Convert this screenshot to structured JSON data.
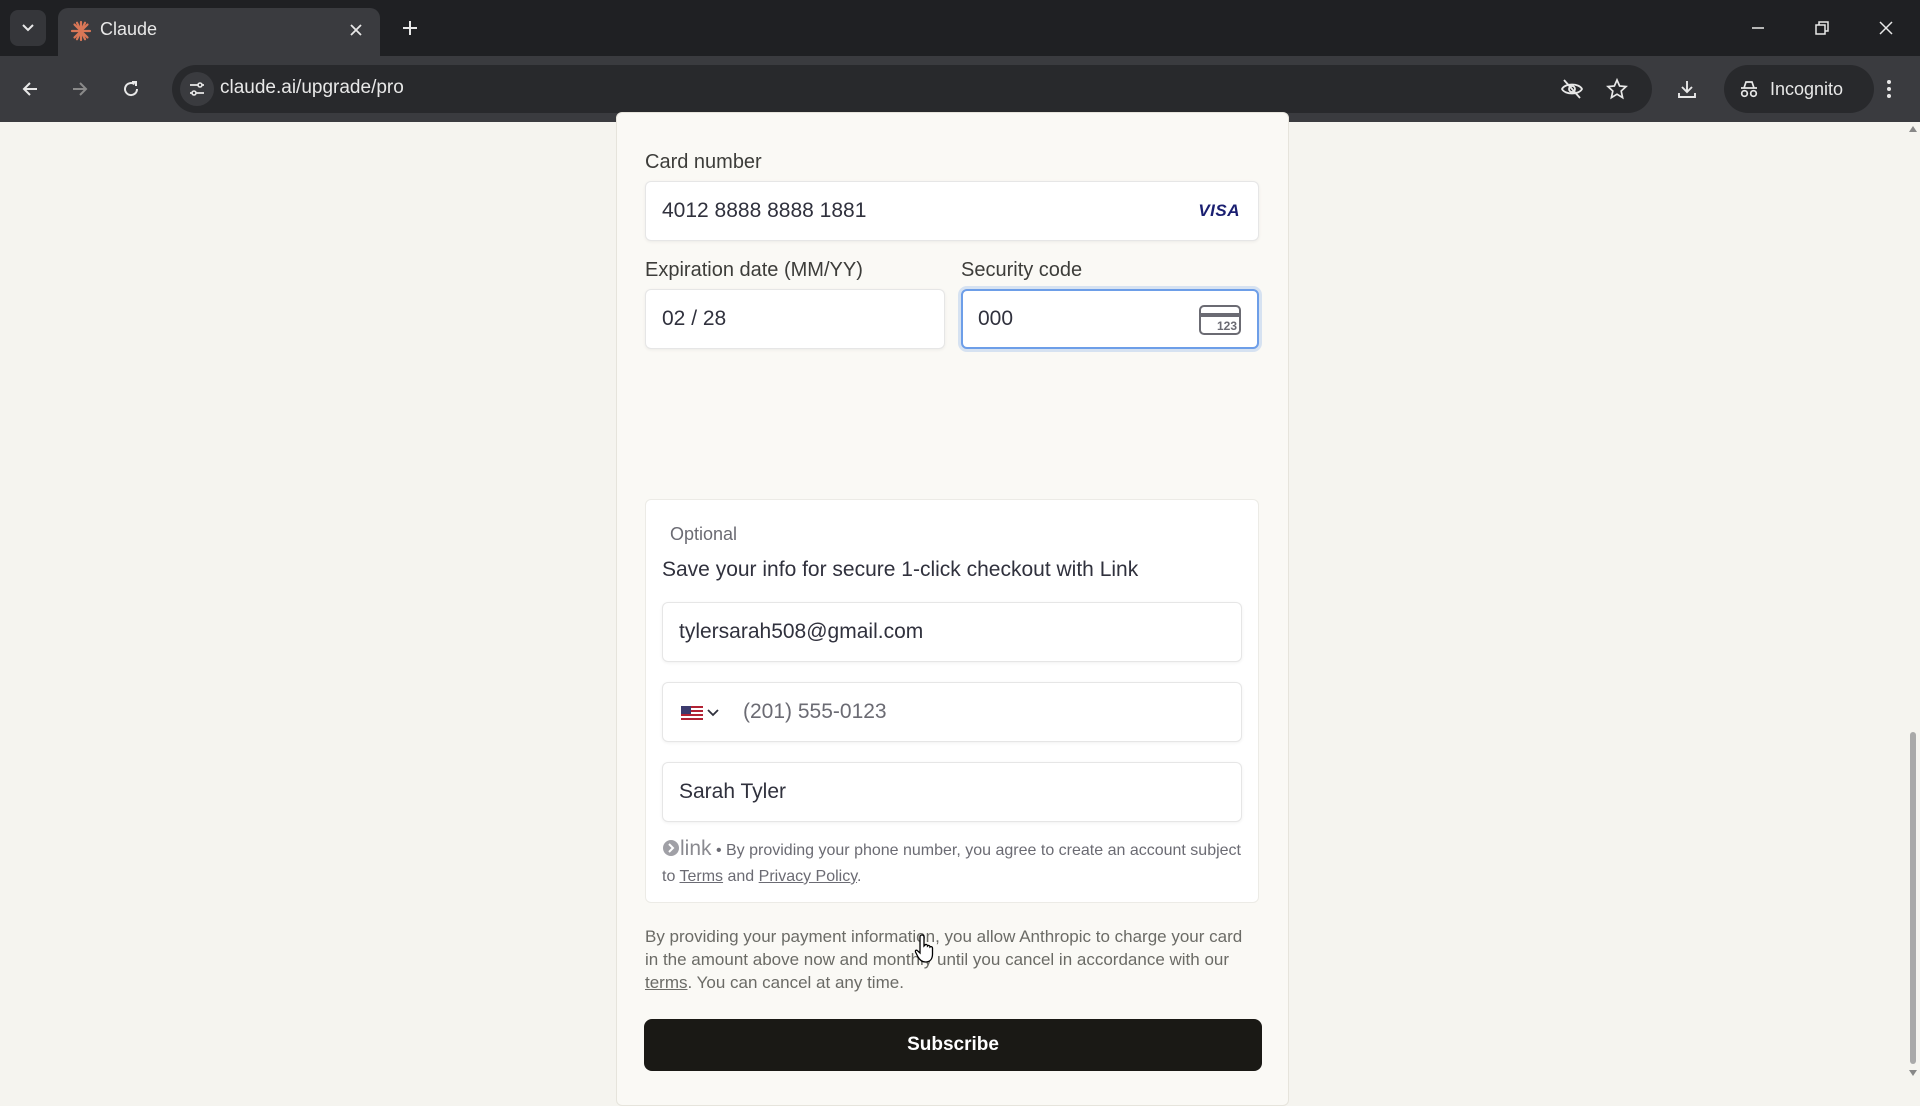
{
  "browser": {
    "tab_title": "Claude",
    "url": "claude.ai/upgrade/pro",
    "incognito_label": "Incognito",
    "icons": [
      "tab-list-icon",
      "claude-favicon-icon",
      "close-icon",
      "plus-icon",
      "minimize-icon",
      "restore-icon",
      "close-window-icon",
      "back-icon",
      "forward-icon",
      "reload-icon",
      "site-info-icon",
      "eye-off-icon",
      "star-icon",
      "download-icon",
      "incognito-icon",
      "more-icon"
    ]
  },
  "form": {
    "card_number_label": "Card number",
    "card_number_value": "4012 8888 8888 1881",
    "card_brand": "VISA",
    "expiration_label": "Expiration date (MM/YY)",
    "expiration_value": "02 / 28",
    "security_label": "Security code",
    "security_value": "000",
    "cvc_hint": "123"
  },
  "link": {
    "optional_label": "Optional",
    "heading": "Save your info for secure 1-click checkout with Link",
    "email_value": "tylersarah508@gmail.com",
    "phone_placeholder": "(201) 555-0123",
    "name_value": "Sarah Tyler",
    "brand": "link",
    "disclaimer_1": " • By providing your phone number, you agree to create an account subject to ",
    "terms_link": "Terms",
    "and_text": " and ",
    "privacy_link": "Privacy Policy",
    "period": "."
  },
  "legal": {
    "text_1": "By providing your payment information, you allow Anthropic to charge your card in the amount above now and monthly until you cancel in accordance with our ",
    "terms_link": "terms",
    "text_2": ". You can cancel at any time."
  },
  "subscribe_label": "Subscribe",
  "colors": {
    "accent_focus": "#6d9ee8",
    "button_bg": "#1a1915",
    "page_bg": "#f5f4ef",
    "visa_blue": "#1a1f71",
    "claude_orange": "#d97757"
  }
}
